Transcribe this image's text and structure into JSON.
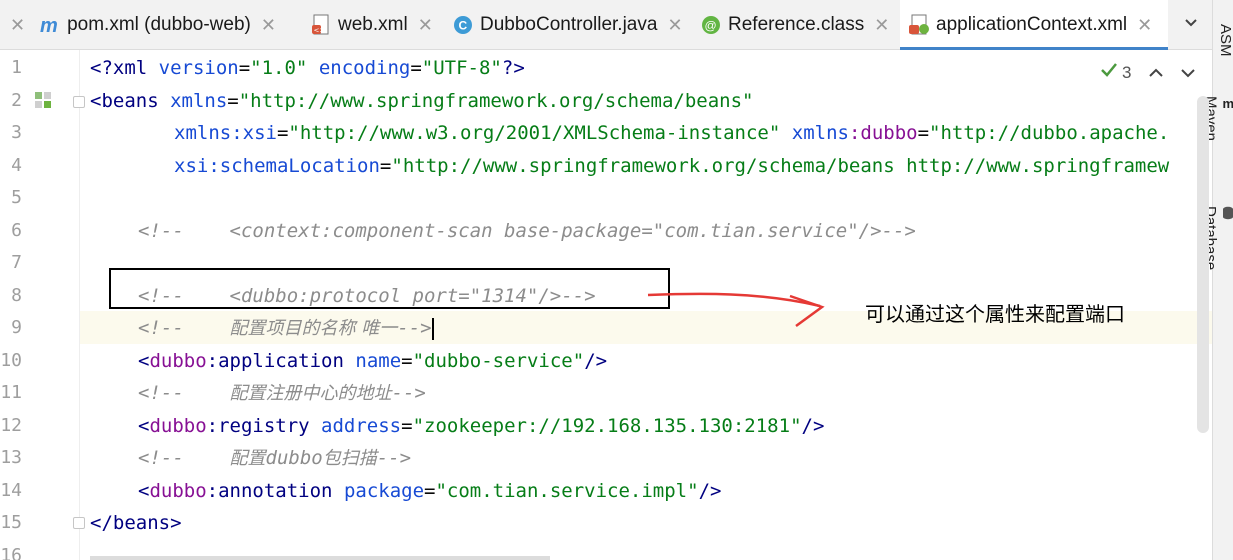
{
  "tabs": [
    {
      "label": "pom.xml (dubbo-web)",
      "icon": "maven-icon"
    },
    {
      "label": "web.xml",
      "icon": "xml-file-icon"
    },
    {
      "label": "DubboController.java",
      "icon": "java-class-icon"
    },
    {
      "label": "Reference.class",
      "icon": "annotation-class-icon"
    },
    {
      "label": "applicationContext.xml",
      "icon": "xml-file-icon"
    }
  ],
  "close_glyph": "✕",
  "tool_windows": [
    "ASM",
    "Maven",
    "Database"
  ],
  "inspection": {
    "count": "3"
  },
  "line_numbers": [
    "1",
    "2",
    "3",
    "4",
    "5",
    "6",
    "7",
    "8",
    "9",
    "10",
    "11",
    "12",
    "13",
    "14",
    "15",
    "16"
  ],
  "code": {
    "l1": {
      "a": "<?xml ",
      "b": "version",
      "c": "=",
      "d": "\"1.0\"",
      "e": " ",
      "f": "encoding",
      "g": "=",
      "h": "\"UTF-8\"",
      "i": "?>"
    },
    "l2": {
      "a": "<beans ",
      "b": "xmlns",
      "c": "=",
      "d": "\"http://www.springframework.org/schema/beans\""
    },
    "l3": {
      "a": "xmlns",
      "b": ":xsi",
      "c": "=",
      "d": "\"http://www.w3.org/2001/XMLSchema-instance\"",
      "e": " xmlns",
      "f": ":dubbo",
      "g": "=",
      "h": "\"http://dubbo.apache."
    },
    "l4": {
      "a": "xsi",
      "b": ":schemaLocation",
      "c": "=",
      "d": "\"http://www.springframework.org/schema/beans http://www.springframew"
    },
    "l6": "<!--    <context:component-scan base-package=\"com.tian.service\"/>-->",
    "l8": "<!--    <dubbo:protocol port=\"1314\"/>-->",
    "l9a": "<!--    ",
    "l9b": "配置项目的名称 唯一",
    "l9c": "-->",
    "l10": {
      "a": "<",
      "b": "dubbo",
      "c": ":application ",
      "d": "name",
      "e": "=",
      "f": "\"dubbo-service\"",
      "g": "/>"
    },
    "l11a": "<!--    ",
    "l11b": "配置注册中心的地址",
    "l11c": "-->",
    "l12": {
      "a": "<",
      "b": "dubbo",
      "c": ":registry ",
      "d": "address",
      "e": "=",
      "f": "\"zookeeper://192.168.135.130:2181\"",
      "g": "/>"
    },
    "l13a": "<!--    ",
    "l13b": "配置",
    "l13c": "dubbo",
    "l13d": "包扫描",
    "l13e": "-->",
    "l14": {
      "a": "<",
      "b": "dubbo",
      "c": ":annotation ",
      "d": "package",
      "e": "=",
      "f": "\"com.tian.service.impl\"",
      "g": "/>"
    },
    "l15": "</beans>"
  },
  "annotation": {
    "text": "可以通过这个属性来配置端口"
  }
}
